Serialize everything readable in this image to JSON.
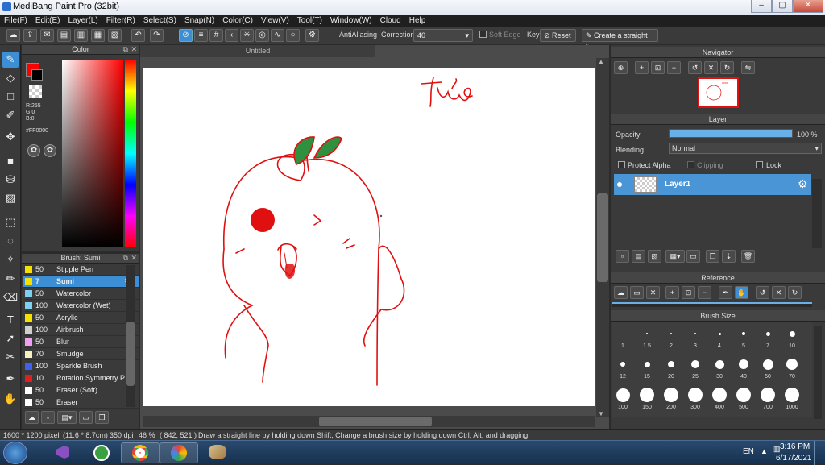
{
  "window": {
    "title": "MediBang Paint Pro (32bit)",
    "min": "–",
    "max": "▢",
    "close": "✕"
  },
  "menu": [
    "File(F)",
    "Edit(E)",
    "Layer(L)",
    "Filter(R)",
    "Select(S)",
    "Snap(N)",
    "Color(C)",
    "View(V)",
    "Tool(T)",
    "Window(W)",
    "Cloud",
    "Help"
  ],
  "toolbar": {
    "antialiasing_label": "AntiAliasing",
    "correction_label": "Correction",
    "correction_value": "40",
    "soft_edge_label": "Soft Edge",
    "key_label": "Key",
    "reset_label": "Reset",
    "straight_line_label": "Create a straight line"
  },
  "color_panel": {
    "title": "Color",
    "r": "R:255",
    "g": "G:0",
    "b": "B:0",
    "hex": "#FF0000",
    "current_color": "#FF0000"
  },
  "brush_panel": {
    "title": "Brush: Sumi",
    "items": [
      {
        "size": "50",
        "name": "Stipple Pen",
        "color": "#f5e000"
      },
      {
        "size": "7",
        "name": "Sumi",
        "color": "#f5e000",
        "selected": true
      },
      {
        "size": "50",
        "name": "Watercolor",
        "color": "#7fd0f0"
      },
      {
        "size": "100",
        "name": "Watercolor (Wet)",
        "color": "#7fd0f0"
      },
      {
        "size": "50",
        "name": "Acrylic",
        "color": "#f5e000"
      },
      {
        "size": "100",
        "name": "Airbrush",
        "color": "#cfcfcf"
      },
      {
        "size": "50",
        "name": "Blur",
        "color": "#f0a0f0"
      },
      {
        "size": "70",
        "name": "Smudge",
        "color": "#f5f0c0"
      },
      {
        "size": "100",
        "name": "Sparkle Brush",
        "color": "#4060f0"
      },
      {
        "size": "10",
        "name": "Rotation Symmetry P",
        "color": "#e02020"
      },
      {
        "size": "50",
        "name": "Eraser (Soft)",
        "color": "#ffffff"
      },
      {
        "size": "50",
        "name": "Eraser",
        "color": "#ffffff"
      }
    ]
  },
  "canvas": {
    "tab": "Untitled",
    "signature": "Thảo"
  },
  "navigator": {
    "title": "Navigator"
  },
  "layer_panel": {
    "title": "Layer",
    "opacity_label": "Opacity",
    "opacity_value": "100 %",
    "opacity": 1.0,
    "blending_label": "Blending",
    "blending_value": "Normal",
    "protect_alpha": "Protect Alpha",
    "clipping": "Clipping",
    "lock": "Lock",
    "layer_name": "Layer1"
  },
  "reference": {
    "title": "Reference"
  },
  "brush_size": {
    "title": "Brush Size",
    "sizes": [
      "1",
      "1.5",
      "2",
      "3",
      "4",
      "5",
      "7",
      "10",
      "12",
      "15",
      "20",
      "25",
      "30",
      "40",
      "50",
      "70",
      "100",
      "150",
      "200",
      "300",
      "400",
      "500",
      "700",
      "1000"
    ]
  },
  "status": {
    "size": "1600 * 1200 pixel",
    "cm": "(11.6 * 8.7cm)",
    "dpi": "350 dpi",
    "zoom": "46 %",
    "coords": "( 842, 521 )",
    "hint": "Draw a straight line by holding down Shift, Change a brush size by holding down Ctrl, Alt, and dragging"
  },
  "taskbar": {
    "lang": "EN",
    "time": "3:16 PM",
    "date": "6/17/2021"
  }
}
